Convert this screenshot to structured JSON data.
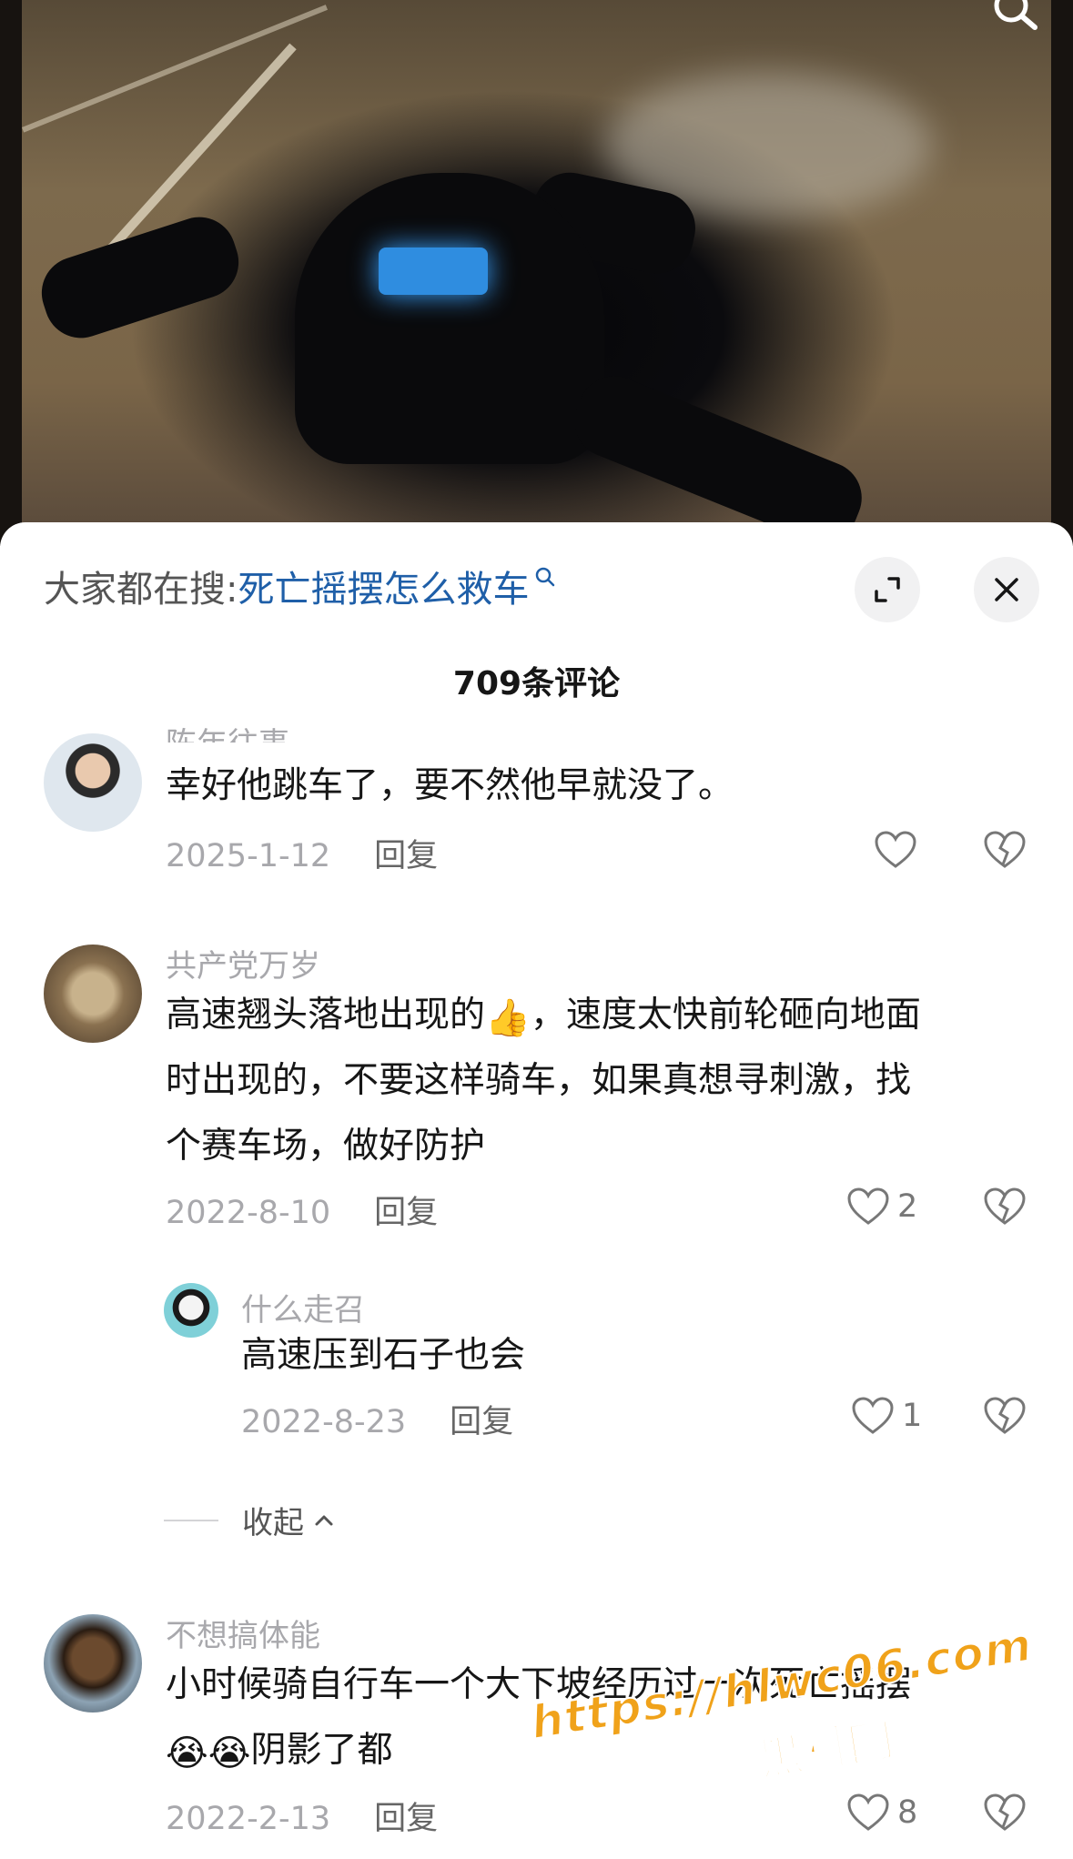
{
  "search": {
    "prefix": "大家都在搜:",
    "query": "死亡摇摆怎么救车"
  },
  "comments_header": {
    "count_label": "709条评论"
  },
  "comments": [
    {
      "username": "陈年往事",
      "text": "幸好他跳车了，要不然他早就没了。",
      "date": "2025-1-12",
      "reply_label": "回复",
      "like_count": ""
    },
    {
      "username": "共产党万岁",
      "text_line1_before_emoji": "高速翘头落地出现的",
      "emoji": "👍",
      "text_line1_after_emoji": "，速度太快前轮砸向地面",
      "text_line2": "时出现的，不要这样骑车，如果真想寻刺激，找",
      "text_line3": "个赛车场，做好防护",
      "date": "2022-8-10",
      "reply_label": "回复",
      "like_count": "2",
      "replies": [
        {
          "username": "什么走召",
          "text": "高速压到石子也会",
          "date": "2022-8-23",
          "reply_label": "回复",
          "like_count": "1"
        }
      ],
      "collapse_label": "收起"
    },
    {
      "username": "不想搞体能",
      "text_line1": "小时候骑自行车一个大下坡经历过一次死亡摇摆",
      "emoji": "😭😭",
      "text_line2": "阴影了都",
      "date": "2022-2-13",
      "reply_label": "回复",
      "like_count": "8"
    }
  ],
  "watermark": {
    "url": "https://hlwc06.com",
    "site": "黑料网"
  },
  "icons": {
    "search": "search-icon",
    "expand": "expand-icon",
    "close": "close-icon",
    "like": "heart-icon",
    "dislike": "broken-heart-icon",
    "collapse": "chevron-up-icon"
  },
  "colors": {
    "search_query": "#1f5fa8",
    "muted_text": "#a8a8ac",
    "watermark": "#f0a21a"
  }
}
